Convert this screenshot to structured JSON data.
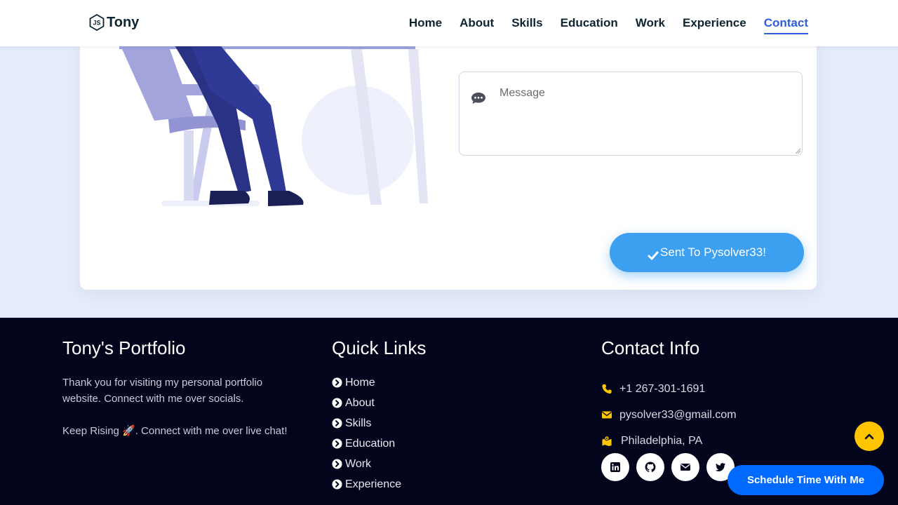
{
  "nav": {
    "brand": "Tony",
    "links": [
      "Home",
      "About",
      "Skills",
      "Education",
      "Work",
      "Experience",
      "Contact"
    ],
    "active": "Contact"
  },
  "form": {
    "message_placeholder": "Message",
    "submit_label": "Sent To Pysolver33!"
  },
  "footer": {
    "about": {
      "title": "Tony's Portfolio",
      "text1": "Thank you for visiting my personal portfolio website. Connect with me over socials.",
      "text2": "Keep Rising 🚀. Connect with me over live chat!"
    },
    "quick_links": {
      "title": "Quick Links",
      "items": [
        "Home",
        "About",
        "Skills",
        "Education",
        "Work",
        "Experience"
      ]
    },
    "contact": {
      "title": "Contact Info",
      "phone": "+1 267-301-1691",
      "email": "pysolver33@gmail.com",
      "location": "Philadelphia, PA"
    },
    "socials": [
      "linkedin-icon",
      "github-icon",
      "envelope-icon",
      "twitter-icon"
    ]
  },
  "schedule_button": "Schedule Time With Me",
  "colors": {
    "accent": "#2f5fd7",
    "submit": "#3c9ff0",
    "footer_bg": "#02051b",
    "icon_yellow": "#ffc500",
    "schedule": "#0069ff"
  }
}
